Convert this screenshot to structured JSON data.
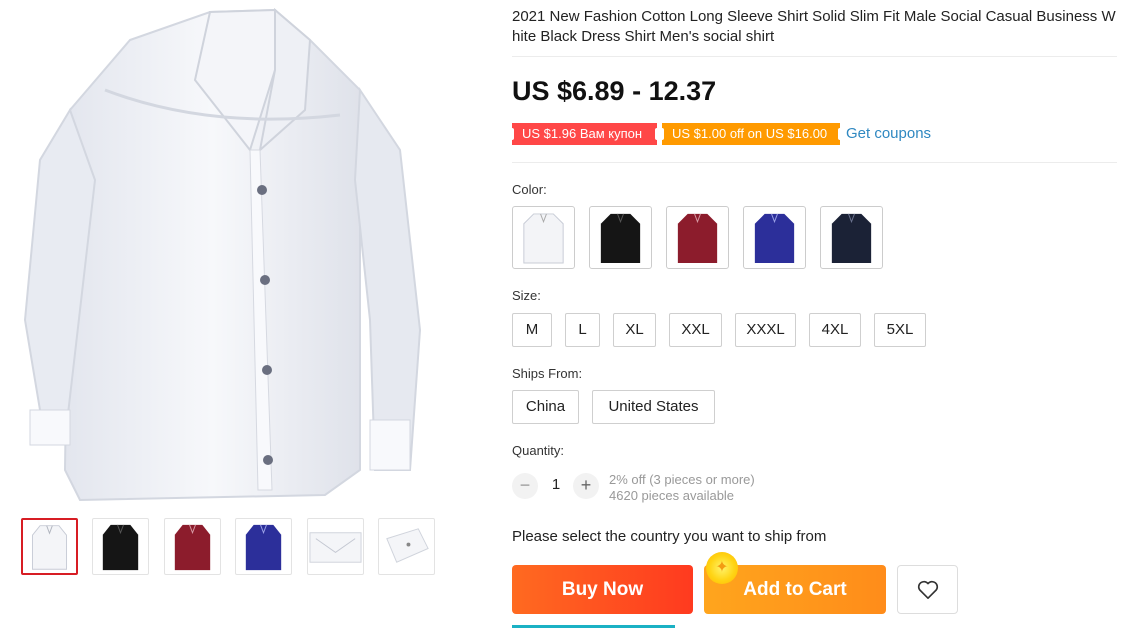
{
  "product": {
    "title": "2021 New Fashion Cotton Long Sleeve Shirt Solid Slim Fit Male Social Casual Business White Black Dress Shirt Men's social shirt",
    "price": "US $6.89 - 12.37"
  },
  "coupons": {
    "coupon_1": "US $1.96 Вам купон",
    "coupon_2": "US $1.00 off on US $16.00",
    "get_coupons": "Get coupons",
    "colors": {
      "coupon_1": "#ff4747",
      "coupon_2": "#ff9a00",
      "link": "#2f88c1"
    }
  },
  "gallery": {
    "thumbnails": [
      {
        "color": "#f4f5f8",
        "label": "white shirt"
      },
      {
        "color": "#151515",
        "label": "black shirt"
      },
      {
        "color": "#8c1c2c",
        "label": "burgundy shirt"
      },
      {
        "color": "#2c2f9a",
        "label": "blue shirt"
      },
      {
        "color": "#f4f5f8",
        "label": "collar detail"
      },
      {
        "color": "#f4f5f8",
        "label": "cuff detail"
      }
    ],
    "selected_index": 0
  },
  "color": {
    "label": "Color:",
    "options": [
      {
        "name": "white",
        "hex": "#f3f4f7"
      },
      {
        "name": "black",
        "hex": "#151515"
      },
      {
        "name": "burgundy",
        "hex": "#8c1c2c"
      },
      {
        "name": "blue",
        "hex": "#2c2f9a"
      },
      {
        "name": "navy",
        "hex": "#1b2236"
      }
    ]
  },
  "size": {
    "label": "Size:",
    "options": [
      "M",
      "L",
      "XL",
      "XXL",
      "XXXL",
      "4XL",
      "5XL"
    ]
  },
  "ships_from": {
    "label": "Ships From:",
    "options": [
      "China",
      "United States"
    ]
  },
  "quantity": {
    "label": "Quantity:",
    "value": "1",
    "minus": "−",
    "plus": "+",
    "discount": "2% off (3 pieces or more)",
    "available": "4620 pieces available"
  },
  "shipping_note": "Please select the country you want to ship from",
  "actions": {
    "buy_now": "Buy Now",
    "add_to_cart": "Add to Cart",
    "buy_now_color": "#ff4a1f",
    "add_to_cart_color": "#ff9a1b",
    "wishlist_icon": "heart-icon"
  }
}
